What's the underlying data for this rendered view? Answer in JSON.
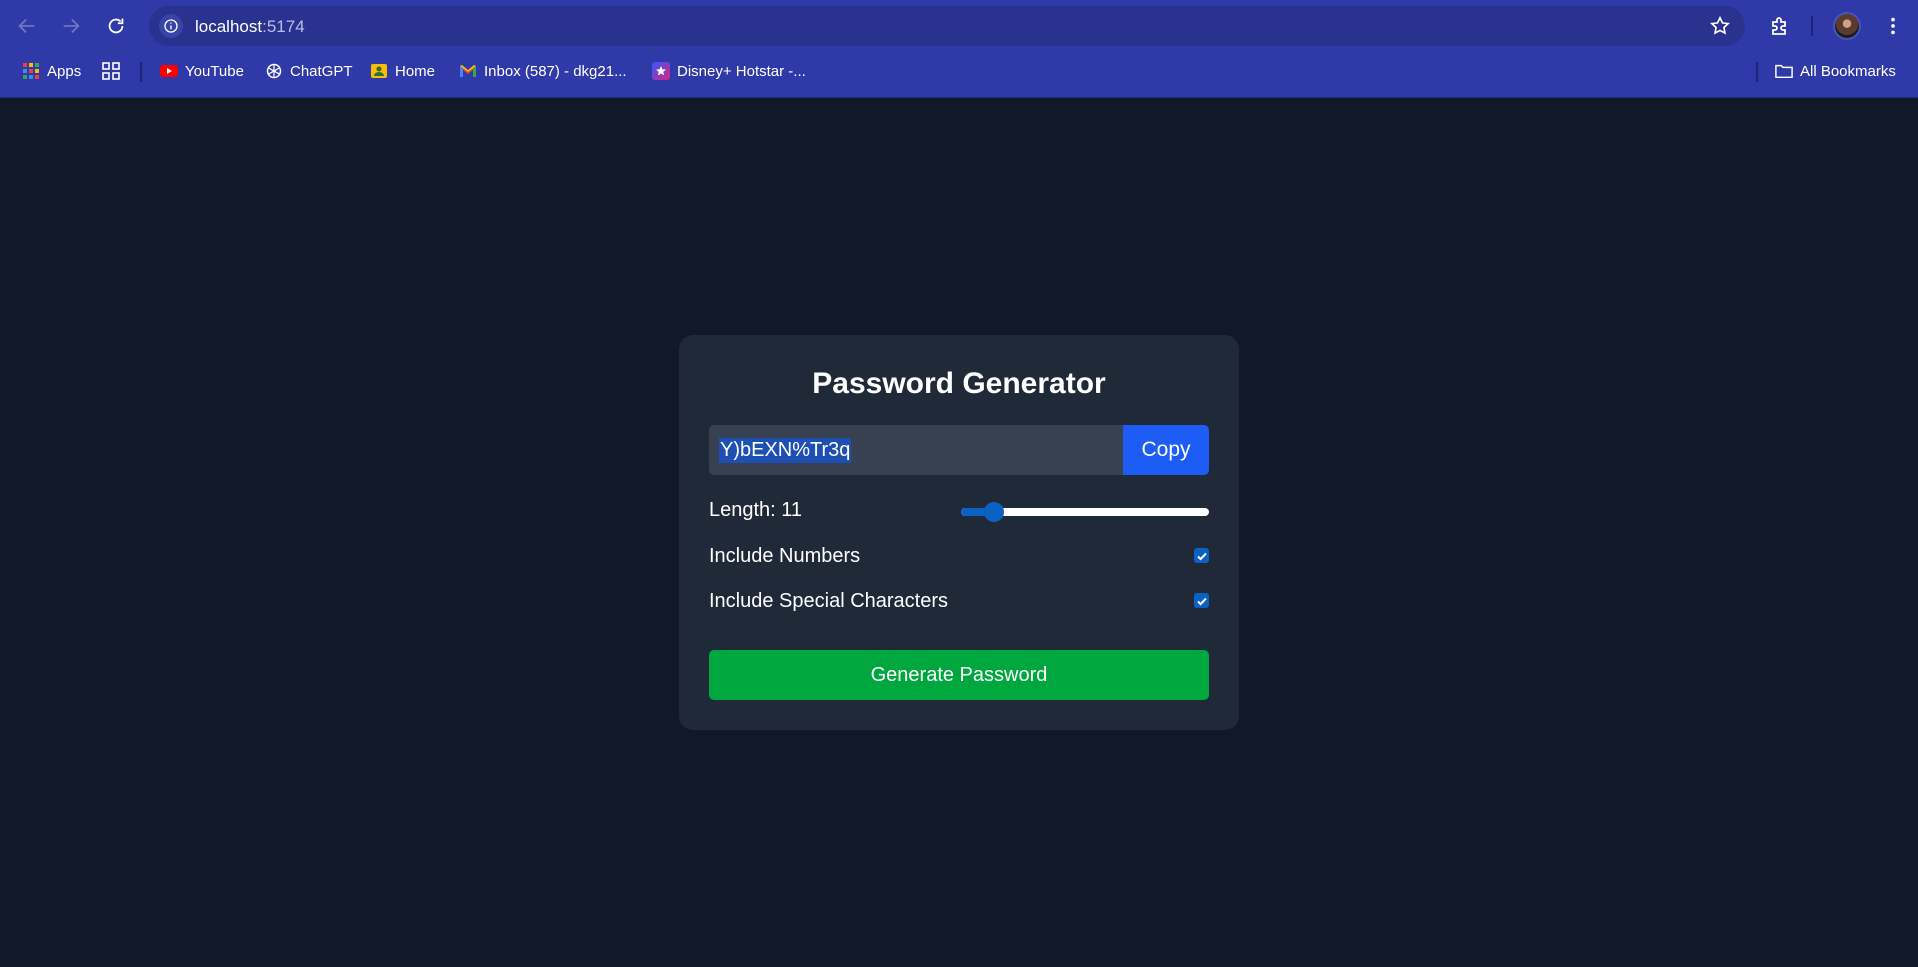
{
  "browser": {
    "url_host": "localhost",
    "url_port": ":5174",
    "bookmarks": [
      {
        "label": "Apps",
        "icon": "apps-grid-icon"
      },
      {
        "label": "",
        "icon": "tab-groups-icon"
      },
      {
        "label": "YouTube",
        "icon": "youtube-icon"
      },
      {
        "label": "ChatGPT",
        "icon": "chatgpt-icon"
      },
      {
        "label": "Home",
        "icon": "home-icon"
      },
      {
        "label": "Inbox (587) - dkg21...",
        "icon": "gmail-icon"
      },
      {
        "label": "Disney+ Hotstar -...",
        "icon": "hotstar-icon"
      }
    ],
    "all_bookmarks": "All Bookmarks"
  },
  "app": {
    "title": "Password Generator",
    "password": "Y)bEXN%Tr3q",
    "copy_label": "Copy",
    "length_label": "Length: 11",
    "length_value": 11,
    "length_fraction": 0.1,
    "include_numbers_label": "Include Numbers",
    "include_numbers": true,
    "include_special_label": "Include Special Characters",
    "include_special": true,
    "generate_label": "Generate Password"
  },
  "colors": {
    "page_bg": "#111827",
    "card_bg": "#1f2937",
    "input_bg": "#374151",
    "copy_button": "#1d5cf5",
    "generate_button": "#00a63e",
    "accent": "#0b61c4",
    "browser_chrome": "#3039a8"
  }
}
